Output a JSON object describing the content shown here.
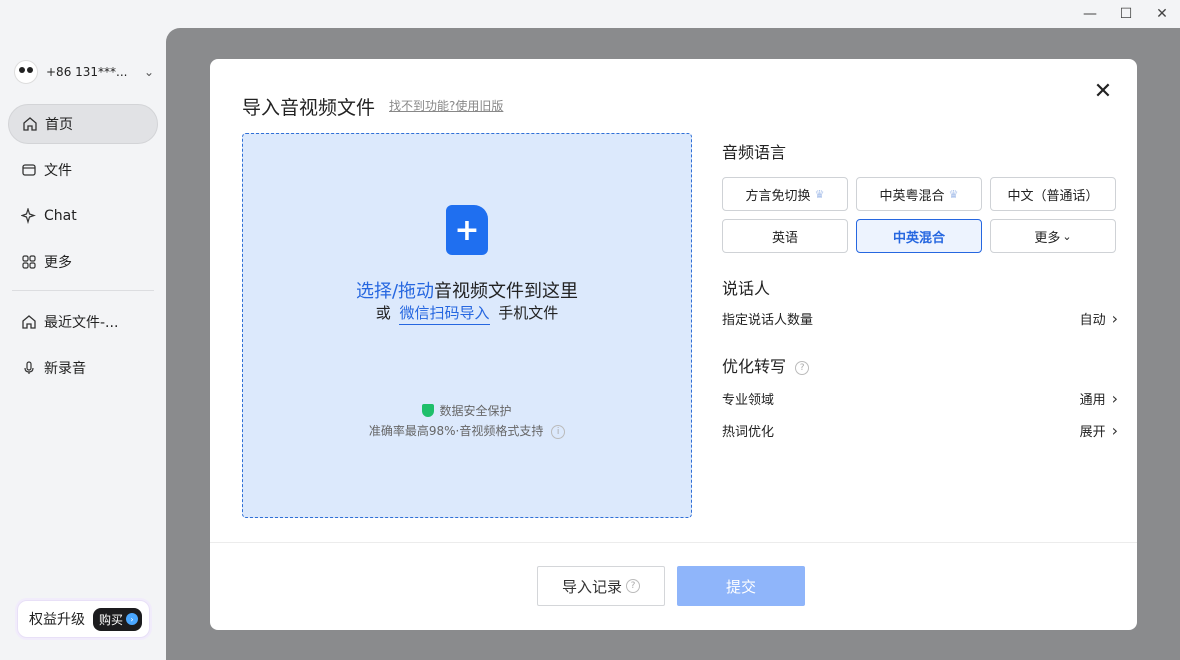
{
  "window": {
    "minimize": "—",
    "maximize": "☐",
    "close": "✕"
  },
  "sidebar": {
    "user": {
      "phone": "+86 131***..."
    },
    "items": [
      {
        "label": "首页",
        "icon": "home-icon",
        "active": true
      },
      {
        "label": "文件",
        "icon": "folder-icon",
        "active": false
      },
      {
        "label": "Chat",
        "icon": "sparkle-icon",
        "active": false
      },
      {
        "label": "更多",
        "icon": "grid-icon",
        "active": false
      }
    ],
    "recent": [
      {
        "label": "最近文件-...",
        "icon": "home-icon"
      },
      {
        "label": "新录音",
        "icon": "mic-icon"
      }
    ],
    "upgrade": {
      "label": "权益升级",
      "buy": "购买"
    }
  },
  "modal": {
    "title": "导入音视频文件",
    "old_version_link": "找不到功能?使用旧版",
    "drop": {
      "select": "选择/拖动",
      "line1_rest": "音视频文件到这里",
      "line2_prefix": "或",
      "wechat": "微信扫码导入",
      "line2_suffix": "手机文件",
      "secure": "数据安全保护",
      "accuracy": "准确率最高98%·音视频格式支持"
    },
    "audio_language": {
      "title": "音频语言",
      "options": [
        {
          "label": "方言免切换",
          "premium": true,
          "selected": false
        },
        {
          "label": "中英粤混合",
          "premium": true,
          "selected": false
        },
        {
          "label": "中文（普通话）",
          "premium": false,
          "selected": false
        },
        {
          "label": "英语",
          "premium": false,
          "selected": false
        },
        {
          "label": "中英混合",
          "premium": false,
          "selected": true
        },
        {
          "label": "更多",
          "premium": false,
          "selected": false
        }
      ]
    },
    "speaker": {
      "title": "说话人",
      "row_label": "指定说话人数量",
      "row_value": "自动"
    },
    "optimize": {
      "title": "优化转写",
      "domain_label": "专业领域",
      "domain_value": "通用",
      "hotword_label": "热词优化",
      "hotword_value": "展开"
    },
    "buttons": {
      "history": "导入记录",
      "submit": "提交"
    }
  }
}
